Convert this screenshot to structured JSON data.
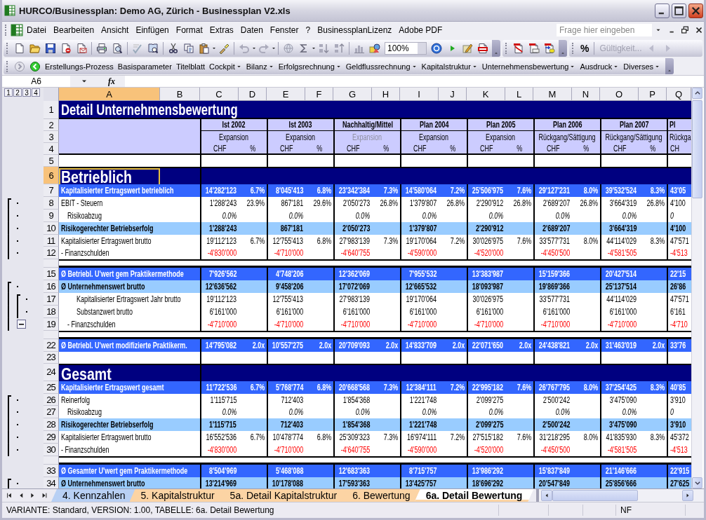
{
  "window": {
    "title": "HURCO/Businessplan: Demo AG, Zürich - Businessplan V2.xls"
  },
  "menu": [
    {
      "label": "Datei"
    },
    {
      "label": "Bearbeiten"
    },
    {
      "label": "Ansicht"
    },
    {
      "label": "Einfügen"
    },
    {
      "label": "Format"
    },
    {
      "label": "Extras"
    },
    {
      "label": "Daten"
    },
    {
      "label": "Fenster"
    },
    {
      "label": "?"
    },
    {
      "label": "BusinessplanLizenz"
    },
    {
      "label": "Adobe PDF"
    }
  ],
  "help_field": {
    "placeholder": "Frage hier eingeben"
  },
  "toolbar": {
    "zoom": "100%",
    "percent_button": "%",
    "validity": {
      "label": "Gültigkeit...",
      "disabled": true
    }
  },
  "custom_toolbar": [
    {
      "label": "Erstellungs-Prozess",
      "dropdown": false
    },
    {
      "label": "Basisparameter",
      "dropdown": false
    },
    {
      "label": "Titelblatt",
      "dropdown": false
    },
    {
      "label": "Cockpit",
      "dropdown": true
    },
    {
      "label": "Bilanz",
      "dropdown": true
    },
    {
      "label": "Erfolgsrechnung",
      "dropdown": true
    },
    {
      "label": "Geldflussrechnung",
      "dropdown": true
    },
    {
      "label": "Kapitalstruktur",
      "dropdown": true
    },
    {
      "label": "Unternehmensbewertung",
      "dropdown": true
    },
    {
      "label": "Ausdruck",
      "dropdown": true
    },
    {
      "label": "Diverses",
      "dropdown": true
    }
  ],
  "formula_bar": {
    "name_box": "A6",
    "function_label": "fx"
  },
  "sheet": {
    "outline_levels": [
      "1",
      "2",
      "3",
      "4"
    ],
    "columns": [
      {
        "letter": "A",
        "selected": true
      },
      {
        "letter": "B",
        "selected": false
      },
      {
        "letter": "C",
        "selected": false
      },
      {
        "letter": "D",
        "selected": false
      },
      {
        "letter": "E",
        "selected": false
      },
      {
        "letter": "F",
        "selected": false
      },
      {
        "letter": "G",
        "selected": false
      },
      {
        "letter": "H",
        "selected": false
      },
      {
        "letter": "I",
        "selected": false
      },
      {
        "letter": "J",
        "selected": false
      },
      {
        "letter": "K",
        "selected": false
      },
      {
        "letter": "L",
        "selected": false
      },
      {
        "letter": "M",
        "selected": false
      },
      {
        "letter": "N",
        "selected": false
      },
      {
        "letter": "O",
        "selected": false
      },
      {
        "letter": "P",
        "selected": false
      },
      {
        "letter": "Q",
        "selected": false
      }
    ],
    "periods": [
      {
        "name": "Ist 2002",
        "phase": "Expansion",
        "dimmed": false,
        "units": [
          "CHF",
          "%"
        ]
      },
      {
        "name": "Ist 2003",
        "phase": "Expansion",
        "dimmed": false,
        "units": [
          "CHF",
          "%"
        ]
      },
      {
        "name": "Nachhaltig/Mittel",
        "phase": "Expansion",
        "dimmed": true,
        "units": [
          "CHF",
          "%"
        ]
      },
      {
        "name": "Plan 2004",
        "phase": "Expansion",
        "dimmed": false,
        "units": [
          "CHF",
          "%"
        ]
      },
      {
        "name": "Plan 2005",
        "phase": "Expansion",
        "dimmed": false,
        "units": [
          "CHF",
          "%"
        ]
      },
      {
        "name": "Plan 2006",
        "phase": "Rückgang/Sättigung",
        "dimmed": false,
        "units": [
          "CHF",
          "%"
        ]
      },
      {
        "name": "Plan 2007",
        "phase": "Rückgang/Sättigung",
        "dimmed": false,
        "units": [
          "CHF",
          "%"
        ]
      },
      {
        "name": "Pl",
        "phase": "Rückga",
        "dimmed": false,
        "units": [
          "CH"
        ]
      }
    ],
    "rows": [
      {
        "number": "1",
        "kind": "title",
        "label": "Detail Unternehmensbewertung",
        "selected": false
      },
      {
        "number": "2",
        "kind": "period_names",
        "selected": false
      },
      {
        "number": "3",
        "kind": "period_subtitles",
        "selected": false
      },
      {
        "number": "4",
        "kind": "units",
        "selected": false
      },
      {
        "number": "5",
        "kind": "blank",
        "selected": false
      },
      {
        "number": "6",
        "kind": "section",
        "label": "Betrieblich",
        "selected": true,
        "active_cell": true
      },
      {
        "number": "7",
        "kind": "total",
        "label": "Kapitalisierter Ertragswert betrieblich",
        "selected": false,
        "cells": [
          [
            "14'282'123",
            "6.7%"
          ],
          [
            "8'045'413",
            "6.8%"
          ],
          [
            "23'342'384",
            "7.3%"
          ],
          [
            "14'580'064",
            "7.2%"
          ],
          [
            "25'506'975",
            "7.6%"
          ],
          [
            "29'127'231",
            "8.0%"
          ],
          [
            "39'532'524",
            "8.3%"
          ],
          [
            "43'05"
          ]
        ]
      },
      {
        "number": "8",
        "kind": "normal",
        "label": "EBIT - Steuern",
        "selected": false,
        "grouped": true,
        "cells": [
          [
            "1'288'243",
            "23.9%"
          ],
          [
            "867'181",
            "29.6%"
          ],
          [
            "2'050'273",
            "26.8%"
          ],
          [
            "1'379'807",
            "26.8%"
          ],
          [
            "2'290'912",
            "26.8%"
          ],
          [
            "2'689'207",
            "26.8%"
          ],
          [
            "3'664'319",
            "26.8%"
          ],
          [
            "4'100"
          ]
        ]
      },
      {
        "number": "9",
        "kind": "risk",
        "label": "Risikoabzug",
        "selected": false,
        "grouped": true,
        "cells": [
          [
            "0.0%"
          ],
          [
            "0.0%"
          ],
          [
            "0.0%"
          ],
          [
            "0.0%"
          ],
          [
            "0.0%"
          ],
          [
            "0.0%"
          ],
          [
            "0.0%"
          ],
          [
            "0"
          ]
        ]
      },
      {
        "number": "10",
        "kind": "subtotal",
        "label": "Risikogerechter Betriebserfolg",
        "selected": false,
        "grouped": true,
        "cells": [
          [
            "1'288'243"
          ],
          [
            "867'181"
          ],
          [
            "2'050'273"
          ],
          [
            "1'379'807"
          ],
          [
            "2'290'912"
          ],
          [
            "2'689'207"
          ],
          [
            "3'664'319"
          ],
          [
            "4'100"
          ]
        ]
      },
      {
        "number": "11",
        "kind": "normal",
        "label": "Kapitalisierter Ertragswert brutto",
        "selected": false,
        "grouped": true,
        "cells": [
          [
            "19'112'123",
            "6.7%"
          ],
          [
            "12'755'413",
            "6.8%"
          ],
          [
            "27'983'139",
            "7.3%"
          ],
          [
            "19'170'064",
            "7.2%"
          ],
          [
            "30'026'975",
            "7.6%"
          ],
          [
            "33'577'731",
            "8.0%"
          ],
          [
            "44'114'029",
            "8.3%"
          ],
          [
            "47'571"
          ]
        ]
      },
      {
        "number": "12",
        "kind": "debt",
        "label": "- Finanzschulden",
        "selected": false,
        "grouped": true,
        "cells": [
          [
            "-4'830'000"
          ],
          [
            "-4'710'000"
          ],
          [
            "-4'640'755"
          ],
          [
            "-4'590'000"
          ],
          [
            "-4'520'000"
          ],
          [
            "-4'450'500"
          ],
          [
            "-4'581'505"
          ],
          [
            "-4'513"
          ]
        ]
      },
      {
        "kind": "hidden"
      },
      {
        "number": "15",
        "kind": "total",
        "label": "Ø Betriebl. U'wert gem Praktikermethode",
        "selected": false,
        "cells": [
          [
            "7'926'562"
          ],
          [
            "4'748'206"
          ],
          [
            "12'362'069"
          ],
          [
            "7'955'532"
          ],
          [
            "13'383'987"
          ],
          [
            "15'159'366"
          ],
          [
            "20'427'514"
          ],
          [
            "22'15"
          ]
        ]
      },
      {
        "number": "16",
        "kind": "subtotal",
        "label": "Ø Unternehmenswert brutto",
        "selected": false,
        "grouped": true,
        "cells": [
          [
            "12'636'562"
          ],
          [
            "9'458'206"
          ],
          [
            "17'072'069"
          ],
          [
            "12'665'532"
          ],
          [
            "18'093'987"
          ],
          [
            "19'869'366"
          ],
          [
            "25'137'514"
          ],
          [
            "26'86"
          ]
        ]
      },
      {
        "number": "17",
        "kind": "detail",
        "label": "Kapitalisierter Ertragswert Jahr brutto",
        "selected": false,
        "subgrouped": true,
        "cells": [
          [
            "19'112'123"
          ],
          [
            "12'755'413"
          ],
          [
            "27'983'139"
          ],
          [
            "19'170'064"
          ],
          [
            "30'026'975"
          ],
          [
            "33'577'731"
          ],
          [
            "44'114'029"
          ],
          [
            "47'571"
          ]
        ]
      },
      {
        "number": "18",
        "kind": "detail",
        "label": "Substanzwert brutto",
        "selected": false,
        "subgrouped": true,
        "cells": [
          [
            "6'161'000"
          ],
          [
            "6'161'000"
          ],
          [
            "6'161'000"
          ],
          [
            "6'161'000"
          ],
          [
            "6'161'000"
          ],
          [
            "6'161'000"
          ],
          [
            "6'161'000"
          ],
          [
            "6'161"
          ]
        ]
      },
      {
        "number": "19",
        "kind": "subdebt",
        "label": "- Finanzschulden",
        "selected": false,
        "collapse_button": true,
        "cells": [
          [
            "-4'710'000"
          ],
          [
            "-4'710'000"
          ],
          [
            "-4'710'000"
          ],
          [
            "-4'710'000"
          ],
          [
            "-4'710'000"
          ],
          [
            "-4'710'000"
          ],
          [
            "-4'710'000"
          ],
          [
            "-4'710"
          ]
        ]
      },
      {
        "kind": "hidden"
      },
      {
        "number": "22",
        "kind": "total",
        "label": "Ø Betriebl. U'wert modifizierte Praktikerm.",
        "selected": false,
        "cells": [
          [
            "14'795'082",
            "2.0x"
          ],
          [
            "10'557'275",
            "2.0x"
          ],
          [
            "20'709'093",
            "2.0x"
          ],
          [
            "14'833'709",
            "2.0x"
          ],
          [
            "22'071'650",
            "2.0x"
          ],
          [
            "24'438'821",
            "2.0x"
          ],
          [
            "31'463'019",
            "2.0x"
          ],
          [
            "33'76"
          ]
        ]
      },
      {
        "number": "23",
        "kind": "blank",
        "selected": false
      },
      {
        "number": "24",
        "kind": "section",
        "label": "Gesamt",
        "selected": false,
        "active_cell": false
      },
      {
        "number": "25",
        "kind": "total",
        "label": "Kapitalisierter Ertragswert gesamt",
        "selected": false,
        "cells": [
          [
            "11'722'536",
            "6.7%"
          ],
          [
            "5'768'774",
            "6.8%"
          ],
          [
            "20'668'568",
            "7.3%"
          ],
          [
            "12'384'111",
            "7.2%"
          ],
          [
            "22'995'182",
            "7.6%"
          ],
          [
            "26'767'795",
            "8.0%"
          ],
          [
            "37'254'425",
            "8.3%"
          ],
          [
            "40'85"
          ]
        ]
      },
      {
        "number": "26",
        "kind": "normal",
        "label": "Reinerfolg",
        "selected": false,
        "grouped": true,
        "cells": [
          [
            "1'115'715"
          ],
          [
            "712'403"
          ],
          [
            "1'854'368"
          ],
          [
            "1'221'748"
          ],
          [
            "2'099'275"
          ],
          [
            "2'500'242"
          ],
          [
            "3'475'090"
          ],
          [
            "3'910"
          ]
        ]
      },
      {
        "number": "27",
        "kind": "risk",
        "label": "Risikoabzug",
        "selected": false,
        "grouped": true,
        "cells": [
          [
            "0.0%"
          ],
          [
            "0.0%"
          ],
          [
            "0.0%"
          ],
          [
            "0.0%"
          ],
          [
            "0.0%"
          ],
          [
            "0.0%"
          ],
          [
            "0.0%"
          ],
          [
            "0"
          ]
        ]
      },
      {
        "number": "28",
        "kind": "subtotal",
        "label": "Risikogerechter Betriebserfolg",
        "selected": false,
        "grouped": true,
        "cells": [
          [
            "1'115'715"
          ],
          [
            "712'403"
          ],
          [
            "1'854'368"
          ],
          [
            "1'221'748"
          ],
          [
            "2'099'275"
          ],
          [
            "2'500'242"
          ],
          [
            "3'475'090"
          ],
          [
            "3'910"
          ]
        ]
      },
      {
        "number": "29",
        "kind": "normal",
        "label": "Kapitalisierter Ertragswert brutto",
        "selected": false,
        "grouped": true,
        "cells": [
          [
            "16'552'536",
            "6.7%"
          ],
          [
            "10'478'774",
            "6.8%"
          ],
          [
            "25'309'323",
            "7.3%"
          ],
          [
            "16'974'111",
            "7.2%"
          ],
          [
            "27'515'182",
            "7.6%"
          ],
          [
            "31'218'295",
            "8.0%"
          ],
          [
            "41'835'930",
            "8.3%"
          ],
          [
            "45'372"
          ]
        ]
      },
      {
        "number": "30",
        "kind": "debt",
        "label": "- Finanzschulden",
        "selected": false,
        "grouped": true,
        "cells": [
          [
            "-4'830'000"
          ],
          [
            "-4'710'000"
          ],
          [
            "-4'640'755"
          ],
          [
            "-4'590'000"
          ],
          [
            "-4'520'000"
          ],
          [
            "-4'450'500"
          ],
          [
            "-4'581'505"
          ],
          [
            "-4'513"
          ]
        ]
      },
      {
        "kind": "hidden"
      },
      {
        "number": "33",
        "kind": "total",
        "label": "Ø Gesamter U'wert gem Praktikermethode",
        "selected": false,
        "cells": [
          [
            "8'504'969"
          ],
          [
            "5'468'088"
          ],
          [
            "12'683'363"
          ],
          [
            "8'715'757"
          ],
          [
            "13'986'292"
          ],
          [
            "15'837'849"
          ],
          [
            "21'146'666"
          ],
          [
            "22'915"
          ]
        ]
      },
      {
        "number": "34",
        "kind": "subtotal",
        "label": "Ø Unternehmenswert brutto",
        "selected": false,
        "grouped": true,
        "cells": [
          [
            "13'214'969"
          ],
          [
            "10'178'088"
          ],
          [
            "17'593'363"
          ],
          [
            "13'425'757"
          ],
          [
            "18'696'292"
          ],
          [
            "20'547'849"
          ],
          [
            "25'856'666"
          ],
          [
            "27'625"
          ]
        ]
      }
    ]
  },
  "sheet_tabs": [
    {
      "label": "4. Kennzahlen",
      "color": "#b8d0f4",
      "selected": false
    },
    {
      "label": "5. Kapitalstruktur",
      "color": "#fcd4a4",
      "selected": false
    },
    {
      "label": "5a. Detail Kapitalstruktur",
      "color": "#fcd4a4",
      "selected": false
    },
    {
      "label": "6. Bewertung",
      "color": "#fcd4a4",
      "selected": false
    },
    {
      "label": "6a. Detail Bewertung",
      "color": "#fcd4a4",
      "selected": true
    }
  ],
  "status_bar": {
    "text": "VARIANTE: Standard, VERSION: 1.00, TABELLE: 6a. Detail Bewertung",
    "mode": "NF"
  }
}
